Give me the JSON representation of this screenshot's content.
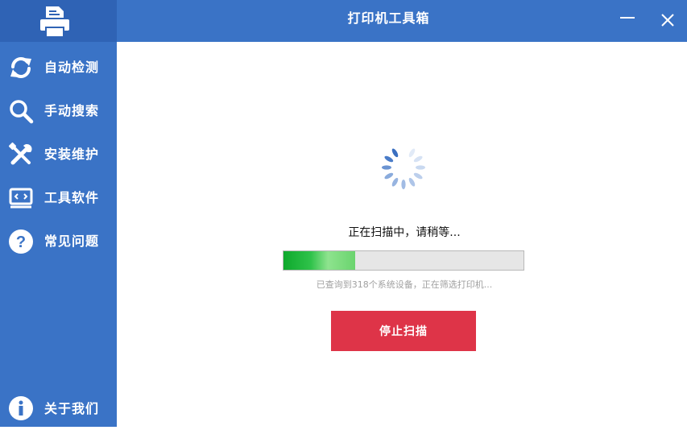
{
  "window": {
    "title": "打印机工具箱",
    "minimize_icon": "minimize-icon",
    "close_icon": "close-icon"
  },
  "sidebar": {
    "logo_icon": "printer-icon",
    "items": [
      {
        "label": "自动检测",
        "icon": "refresh-icon"
      },
      {
        "label": "手动搜索",
        "icon": "search-icon"
      },
      {
        "label": "安装维护",
        "icon": "tools-icon"
      },
      {
        "label": "工具软件",
        "icon": "code-monitor-icon"
      },
      {
        "label": "常见问题",
        "icon": "question-icon"
      }
    ],
    "bottom_item": {
      "label": "关于我们",
      "icon": "info-icon"
    }
  },
  "main": {
    "spinner_icon": "loading-spinner-icon",
    "status": "正在扫描中，请稍等...",
    "progress": 0.3,
    "detail": "已查询到318个系统设备，正在筛选打印机...",
    "stop_label": "停止扫描"
  },
  "colors": {
    "primary": "#3a73c6",
    "logo_background": "#2f63b5",
    "stop_button": "#de3448",
    "progress_green": "#2fc24a"
  }
}
